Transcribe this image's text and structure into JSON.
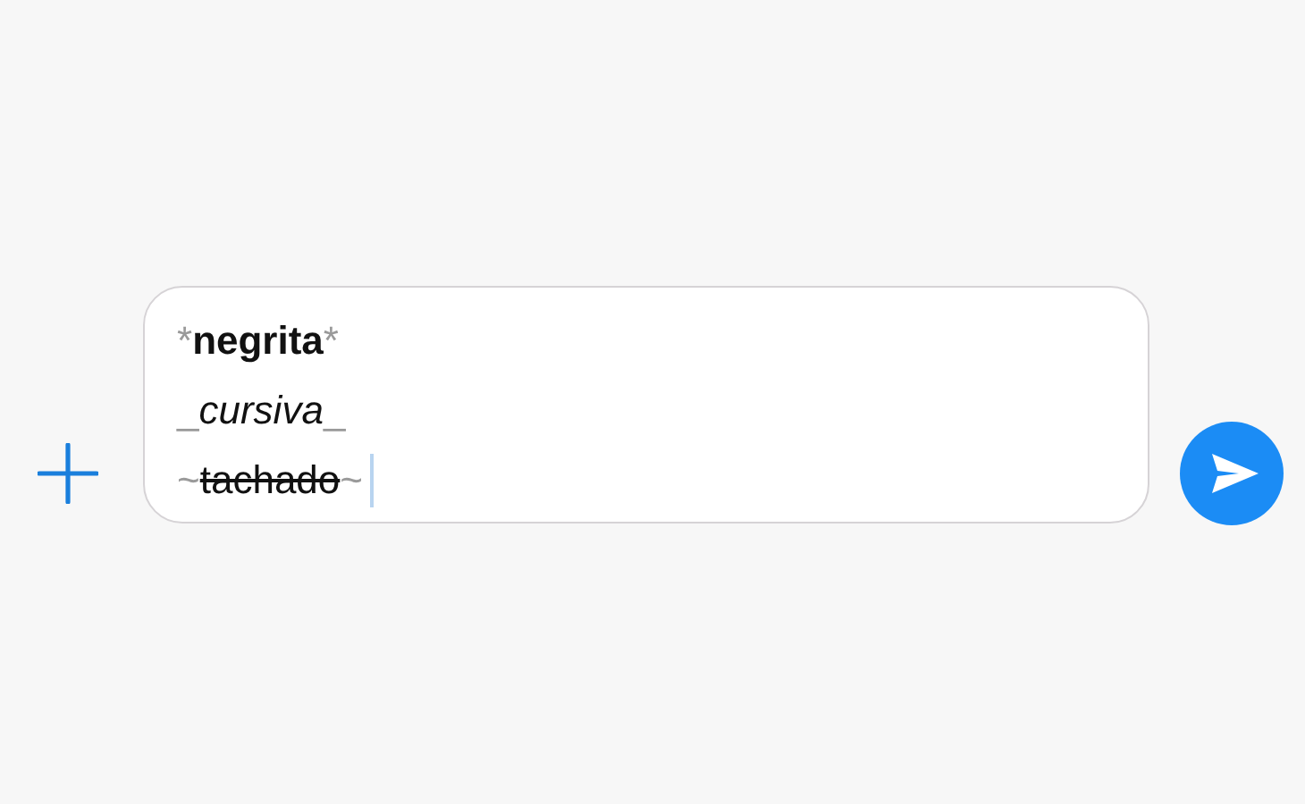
{
  "composer": {
    "lines": [
      {
        "kind": "bold",
        "open": "*",
        "word": "negrita",
        "close": "*"
      },
      {
        "kind": "italic",
        "open": "_",
        "word": "cursiva",
        "close": "_"
      },
      {
        "kind": "strike",
        "open": "~",
        "word": "tachado",
        "close": "~"
      }
    ]
  }
}
